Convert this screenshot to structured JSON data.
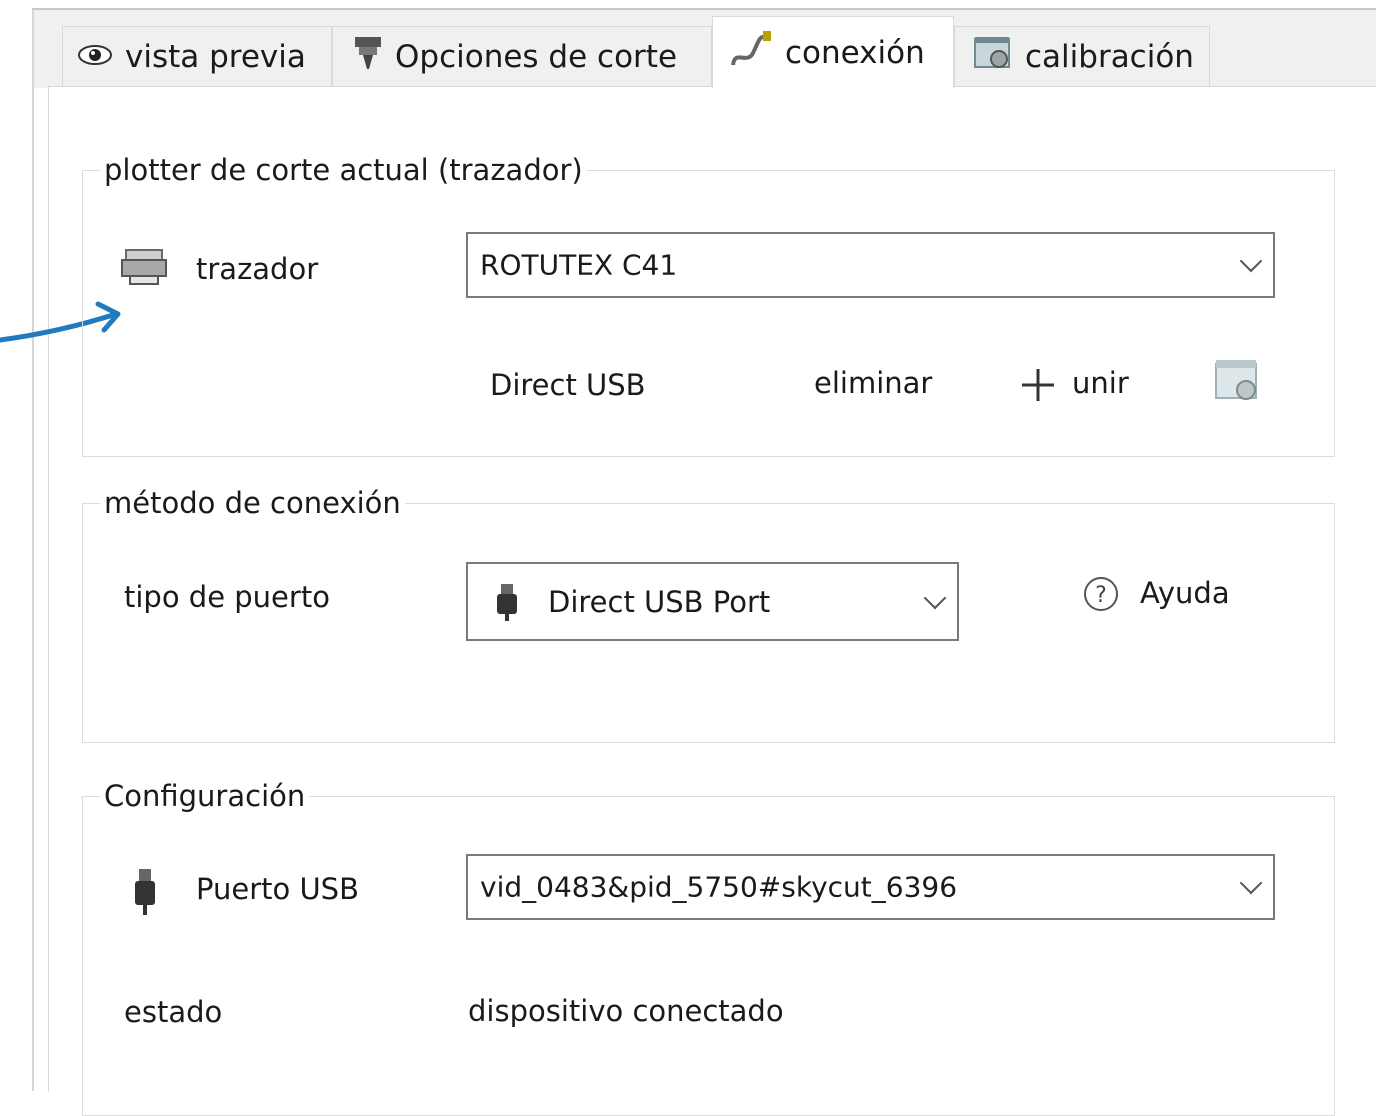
{
  "tabs": [
    {
      "label": "vista previa",
      "icon": "eye-icon"
    },
    {
      "label": "Opciones de corte",
      "icon": "blade-icon"
    },
    {
      "label": "conexión",
      "icon": "cable-icon",
      "active": true
    },
    {
      "label": "calibración",
      "icon": "calibration-icon"
    }
  ],
  "plotter_group": {
    "legend": "plotter de corte actual (trazador)",
    "label": "trazador",
    "selected": "ROTUTEX C41",
    "driver": "Direct USB",
    "delete_label": "eliminar",
    "add_label": "unir"
  },
  "connection_group": {
    "legend": "método de conexión",
    "port_type_label": "tipo de puerto",
    "port_type_value": "Direct USB Port",
    "help_label": "Ayuda"
  },
  "config_group": {
    "legend": "Configuración",
    "usb_port_label": "Puerto USB",
    "usb_port_value": "vid_0483&pid_5750#skycut_6396",
    "status_label": "estado",
    "status_value": "dispositivo conectado"
  },
  "colors": {
    "arrow": "#1f7ac0",
    "border": "#dcdcdc"
  }
}
